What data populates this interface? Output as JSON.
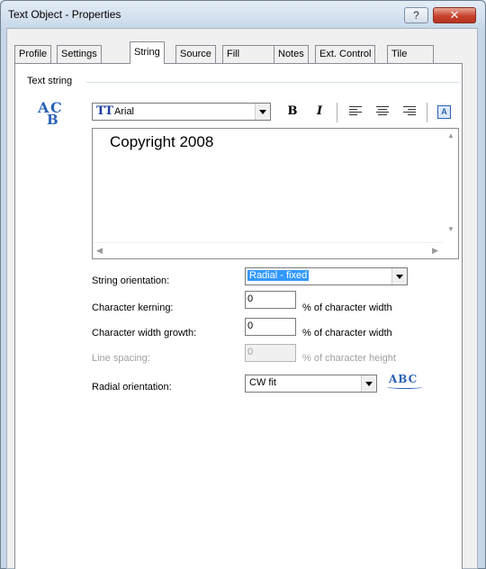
{
  "window": {
    "title": "Text Object - Properties",
    "help_label": "?",
    "close_label": "✕"
  },
  "tabs": [
    {
      "label": "Profile"
    },
    {
      "label": "Settings"
    },
    {
      "label": "String",
      "active": true
    },
    {
      "label": "Source"
    },
    {
      "label": "Fill"
    },
    {
      "label": "Notes"
    },
    {
      "label": "Ext. Control"
    },
    {
      "label": "Tile"
    }
  ],
  "string": {
    "group_label": "Text string",
    "font_name": "Arial",
    "font_icon": "TT",
    "bold_label": "B",
    "italic_label": "I",
    "text_value": "Copyright 2008",
    "orientation_label": "String orientation:",
    "orientation_value": "Radial - fixed",
    "kerning_label": "Character kerning:",
    "kerning_value": "0",
    "kerning_unit": "% of character width",
    "width_growth_label": "Character width growth:",
    "width_growth_value": "0",
    "width_growth_unit": "% of character width",
    "line_spacing_label": "Line spacing:",
    "line_spacing_value": "0",
    "line_spacing_unit": "% of character height",
    "radial_label": "Radial orientation:",
    "radial_value": "CW fit",
    "abc_preview": "ABC"
  },
  "colors": {
    "accent": "#2a62b6",
    "selection": "#3399ff",
    "close": "#c7412c"
  }
}
